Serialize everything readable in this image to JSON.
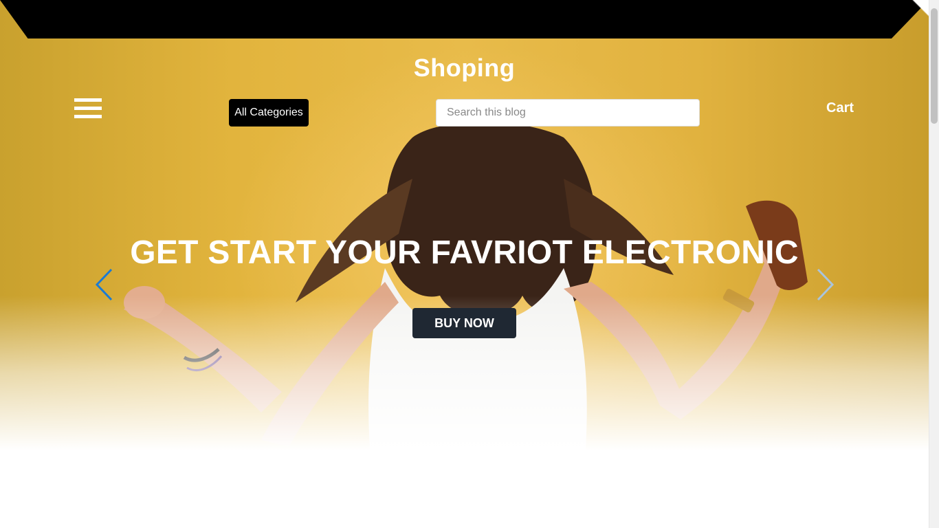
{
  "header": {
    "brand": "Shoping",
    "categories_label": "All Categories",
    "search_placeholder": "Search this blog",
    "cart_label": "Cart"
  },
  "hero": {
    "headline": "GET START YOUR FAVRIOT ELECTRONIC",
    "cta_label": "BUY NOW"
  },
  "icons": {
    "menu": "hamburger-menu-icon",
    "prev": "chevron-left-icon",
    "next": "chevron-right-icon"
  },
  "colors": {
    "hero_background": "#e2b43d",
    "topbar": "#000000",
    "cta_background": "#1f2833",
    "prev_arrow": "#1a7ad4",
    "next_arrow": "#a9c4dd"
  }
}
